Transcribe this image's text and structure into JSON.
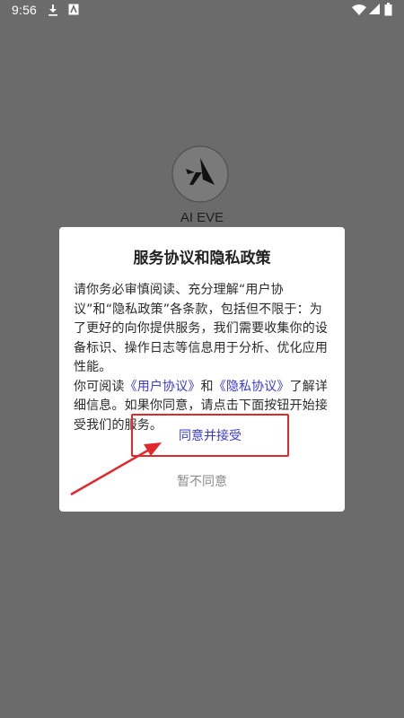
{
  "status_bar": {
    "time": "9:56",
    "left_icons": [
      "download-icon",
      "a-app-icon"
    ],
    "right_icons": [
      "wifi-icon",
      "signal-icon",
      "battery-icon"
    ]
  },
  "app": {
    "name": "AI EVE"
  },
  "dialog": {
    "title": "服务协议和隐私政策",
    "paragraph1": "请你务必审慎阅读、充分理解“用户协议”和“隐私政策”各条款，包括但不限于：为了更好的向你提供服务，我们需要收集你的设备标识、操作日志等信息用于分析、优化应用性能。",
    "p2_prefix": "你可阅读",
    "user_agreement_link": "《用户协议》",
    "p2_and": "和",
    "privacy_policy_link": "《隐私协议》",
    "p2_suffix": "了解详细信息。如果你同意，请点击下面按钮开始接受我们的服务。",
    "accept_label": "同意并接受",
    "reject_label": "暂不同意"
  },
  "colors": {
    "overlay": "#6b6b6b",
    "link": "#3a3ad8",
    "highlight": "#e0282d",
    "muted": "#8a8a8a"
  }
}
